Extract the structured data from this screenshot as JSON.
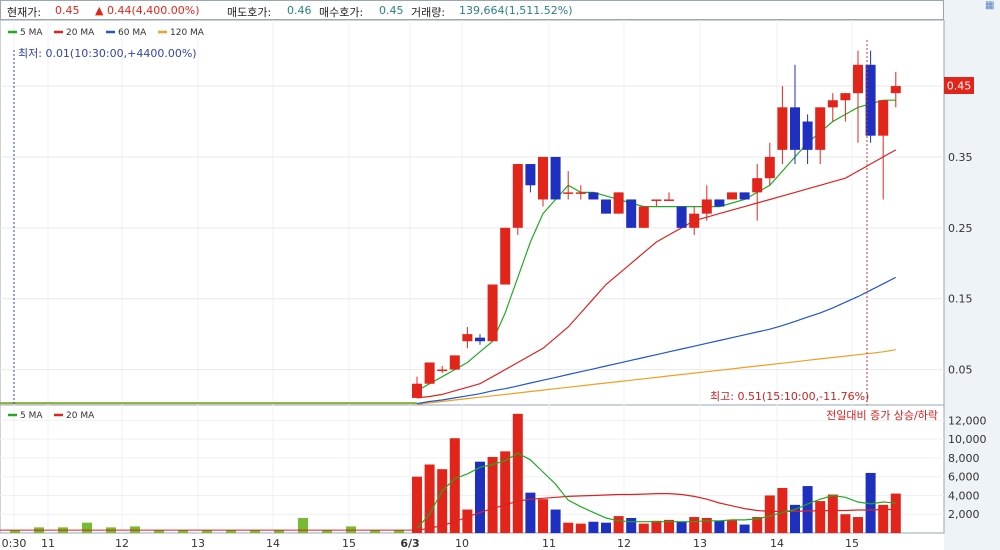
{
  "header": {
    "price_label": "현재가:",
    "price_value": "0.45",
    "change_arrow": "▲",
    "change_value": "0.44(4,400.00%)",
    "ask_label": "매도호가:",
    "ask_value": "0.46",
    "bid_label": "매수호가:",
    "bid_value": "0.45",
    "volume_label": "거래량:",
    "volume_value": "139,664(1,511.52%)"
  },
  "sidebar": {
    "icon": "grid-icon"
  },
  "chart_data": {
    "type": "candlestick",
    "price_legend": [
      {
        "name": "5 MA",
        "color": "#22aa22"
      },
      {
        "name": "20 MA",
        "color": "#dd2222"
      },
      {
        "name": "60 MA",
        "color": "#2255cc"
      },
      {
        "name": "120 MA",
        "color": "#f0a020"
      }
    ],
    "volume_legend": [
      {
        "name": "5 MA",
        "color": "#22aa22"
      },
      {
        "name": "20 MA",
        "color": "#dd2222"
      }
    ],
    "annotations": {
      "low": "최저: 0.01(10:30:00,+4400.00%)",
      "high": "최고: 0.51(15:10:00,-11.76%)",
      "volume_note": "전일대비 증가 상승/하락"
    },
    "current_price_label": "0.45",
    "y_ticks": [
      "0.45",
      "0.35",
      "0.25",
      "0.15",
      "0.05"
    ],
    "y_tick_values": [
      0.45,
      0.35,
      0.25,
      0.15,
      0.05
    ],
    "y_range": [
      0,
      0.515
    ],
    "volume_ticks": [
      "12,000",
      "10,000",
      "8,000",
      "6,000",
      "4,000",
      "2,000"
    ],
    "volume_tick_values": [
      12000,
      10000,
      8000,
      6000,
      4000,
      2000
    ],
    "volume_range": [
      0,
      13000
    ],
    "x_labels": [
      "0:30",
      "11",
      "12",
      "13",
      "14",
      "15",
      "6/3",
      "10",
      "11",
      "12",
      "13",
      "14",
      "15"
    ],
    "prev_day_volume": [
      300,
      600,
      600,
      1100,
      600,
      700,
      300,
      300,
      300,
      300,
      300,
      300,
      1600,
      300,
      700,
      300,
      300
    ],
    "candles": [
      {
        "o": 0.01,
        "h": 0.04,
        "l": 0.01,
        "c": 0.03,
        "v": 6000
      },
      {
        "o": 0.03,
        "h": 0.06,
        "l": 0.03,
        "c": 0.06,
        "v": 7300
      },
      {
        "o": 0.05,
        "h": 0.055,
        "l": 0.045,
        "c": 0.05,
        "v": 6800
      },
      {
        "o": 0.05,
        "h": 0.07,
        "l": 0.05,
        "c": 0.07,
        "v": 10100
      },
      {
        "o": 0.09,
        "h": 0.11,
        "l": 0.08,
        "c": 0.1,
        "v": 2500
      },
      {
        "o": 0.095,
        "h": 0.1,
        "l": 0.085,
        "c": 0.09,
        "v": 7600
      },
      {
        "o": 0.09,
        "h": 0.17,
        "l": 0.09,
        "c": 0.17,
        "v": 8100
      },
      {
        "o": 0.17,
        "h": 0.25,
        "l": 0.17,
        "c": 0.25,
        "v": 8700
      },
      {
        "o": 0.25,
        "h": 0.34,
        "l": 0.24,
        "c": 0.34,
        "v": 12700
      },
      {
        "o": 0.34,
        "h": 0.34,
        "l": 0.3,
        "c": 0.31,
        "v": 4300
      },
      {
        "o": 0.29,
        "h": 0.35,
        "l": 0.28,
        "c": 0.35,
        "v": 3600
      },
      {
        "o": 0.35,
        "h": 0.35,
        "l": 0.29,
        "c": 0.29,
        "v": 2500
      },
      {
        "o": 0.3,
        "h": 0.33,
        "l": 0.29,
        "c": 0.3,
        "v": 1100
      },
      {
        "o": 0.3,
        "h": 0.31,
        "l": 0.29,
        "c": 0.3,
        "v": 1000
      },
      {
        "o": 0.3,
        "h": 0.3,
        "l": 0.29,
        "c": 0.29,
        "v": 1200
      },
      {
        "o": 0.29,
        "h": 0.29,
        "l": 0.27,
        "c": 0.27,
        "v": 1100
      },
      {
        "o": 0.27,
        "h": 0.3,
        "l": 0.27,
        "c": 0.3,
        "v": 1800
      },
      {
        "o": 0.29,
        "h": 0.29,
        "l": 0.25,
        "c": 0.25,
        "v": 1600
      },
      {
        "o": 0.25,
        "h": 0.28,
        "l": 0.25,
        "c": 0.28,
        "v": 1000
      },
      {
        "o": 0.29,
        "h": 0.29,
        "l": 0.28,
        "c": 0.29,
        "v": 1300
      },
      {
        "o": 0.29,
        "h": 0.3,
        "l": 0.29,
        "c": 0.29,
        "v": 1400
      },
      {
        "o": 0.28,
        "h": 0.28,
        "l": 0.25,
        "c": 0.25,
        "v": 1200
      },
      {
        "o": 0.25,
        "h": 0.28,
        "l": 0.24,
        "c": 0.27,
        "v": 1700
      },
      {
        "o": 0.27,
        "h": 0.31,
        "l": 0.26,
        "c": 0.29,
        "v": 1600
      },
      {
        "o": 0.29,
        "h": 0.29,
        "l": 0.28,
        "c": 0.28,
        "v": 1300
      },
      {
        "o": 0.29,
        "h": 0.3,
        "l": 0.29,
        "c": 0.3,
        "v": 1400
      },
      {
        "o": 0.3,
        "h": 0.3,
        "l": 0.29,
        "c": 0.29,
        "v": 900
      },
      {
        "o": 0.3,
        "h": 0.34,
        "l": 0.26,
        "c": 0.32,
        "v": 1700
      },
      {
        "o": 0.32,
        "h": 0.37,
        "l": 0.31,
        "c": 0.35,
        "v": 4000
      },
      {
        "o": 0.36,
        "h": 0.45,
        "l": 0.34,
        "c": 0.42,
        "v": 4800
      },
      {
        "o": 0.42,
        "h": 0.48,
        "l": 0.34,
        "c": 0.36,
        "v": 3000
      },
      {
        "o": 0.4,
        "h": 0.41,
        "l": 0.34,
        "c": 0.36,
        "v": 5000
      },
      {
        "o": 0.36,
        "h": 0.42,
        "l": 0.34,
        "c": 0.42,
        "v": 3400
      },
      {
        "o": 0.42,
        "h": 0.44,
        "l": 0.4,
        "c": 0.43,
        "v": 4100
      },
      {
        "o": 0.43,
        "h": 0.44,
        "l": 0.4,
        "c": 0.44,
        "v": 2000
      },
      {
        "o": 0.44,
        "h": 0.5,
        "l": 0.37,
        "c": 0.48,
        "v": 1700
      },
      {
        "o": 0.48,
        "h": 0.5,
        "l": 0.37,
        "c": 0.38,
        "v": 6400
      },
      {
        "o": 0.38,
        "h": 0.43,
        "l": 0.29,
        "c": 0.43,
        "v": 3000
      },
      {
        "o": 0.44,
        "h": 0.47,
        "l": 0.42,
        "c": 0.45,
        "v": 4200
      }
    ],
    "ma5": [
      0.02,
      0.03,
      0.04,
      0.05,
      0.06,
      0.075,
      0.09,
      0.13,
      0.18,
      0.23,
      0.27,
      0.29,
      0.31,
      0.3,
      0.3,
      0.295,
      0.29,
      0.285,
      0.28,
      0.28,
      0.28,
      0.28,
      0.28,
      0.28,
      0.28,
      0.285,
      0.29,
      0.3,
      0.31,
      0.33,
      0.35,
      0.37,
      0.385,
      0.4,
      0.41,
      0.42,
      0.425,
      0.43,
      0.43
    ],
    "ma20": [
      0.01,
      0.012,
      0.015,
      0.02,
      0.025,
      0.03,
      0.04,
      0.05,
      0.06,
      0.07,
      0.08,
      0.095,
      0.11,
      0.13,
      0.15,
      0.17,
      0.185,
      0.2,
      0.215,
      0.23,
      0.24,
      0.25,
      0.26,
      0.265,
      0.27,
      0.275,
      0.28,
      0.285,
      0.29,
      0.295,
      0.3,
      0.305,
      0.31,
      0.315,
      0.32,
      0.33,
      0.34,
      0.35,
      0.36
    ],
    "ma60": [
      0.002,
      0.005,
      0.007,
      0.01,
      0.013,
      0.016,
      0.02,
      0.023,
      0.027,
      0.031,
      0.035,
      0.039,
      0.043,
      0.047,
      0.051,
      0.055,
      0.059,
      0.063,
      0.067,
      0.071,
      0.075,
      0.079,
      0.083,
      0.087,
      0.091,
      0.095,
      0.099,
      0.103,
      0.107,
      0.112,
      0.118,
      0.124,
      0.13,
      0.137,
      0.145,
      0.153,
      0.162,
      0.171,
      0.18
    ],
    "ma120": [
      0.001,
      0.003,
      0.005,
      0.007,
      0.009,
      0.011,
      0.013,
      0.015,
      0.017,
      0.019,
      0.021,
      0.023,
      0.025,
      0.027,
      0.029,
      0.031,
      0.033,
      0.035,
      0.037,
      0.039,
      0.041,
      0.043,
      0.045,
      0.047,
      0.049,
      0.051,
      0.053,
      0.055,
      0.057,
      0.059,
      0.061,
      0.063,
      0.065,
      0.067,
      0.069,
      0.071,
      0.073,
      0.075,
      0.078
    ],
    "vol_ma5": [
      500,
      2000,
      4500,
      5800,
      6300,
      7000,
      7300,
      7700,
      8500,
      7800,
      6500,
      5200,
      3500,
      2800,
      2200,
      1600,
      1300,
      1200,
      1200,
      1200,
      1200,
      1200,
      1200,
      1300,
      1300,
      1400,
      1400,
      1500,
      1800,
      2200,
      2500,
      3100,
      3600,
      4000,
      3800,
      3300,
      3100,
      3300,
      3200
    ],
    "vol_ma20": [
      300,
      500,
      800,
      1200,
      1700,
      2200,
      2600,
      3000,
      3400,
      3600,
      3700,
      3800,
      3900,
      3950,
      4000,
      4050,
      4100,
      4100,
      4150,
      4200,
      4200,
      4100,
      3900,
      3600,
      3200,
      2900,
      2600,
      2400,
      2300,
      2300,
      2300,
      2350,
      2350,
      2400,
      2400,
      2450,
      2450,
      2500,
      2500
    ]
  }
}
